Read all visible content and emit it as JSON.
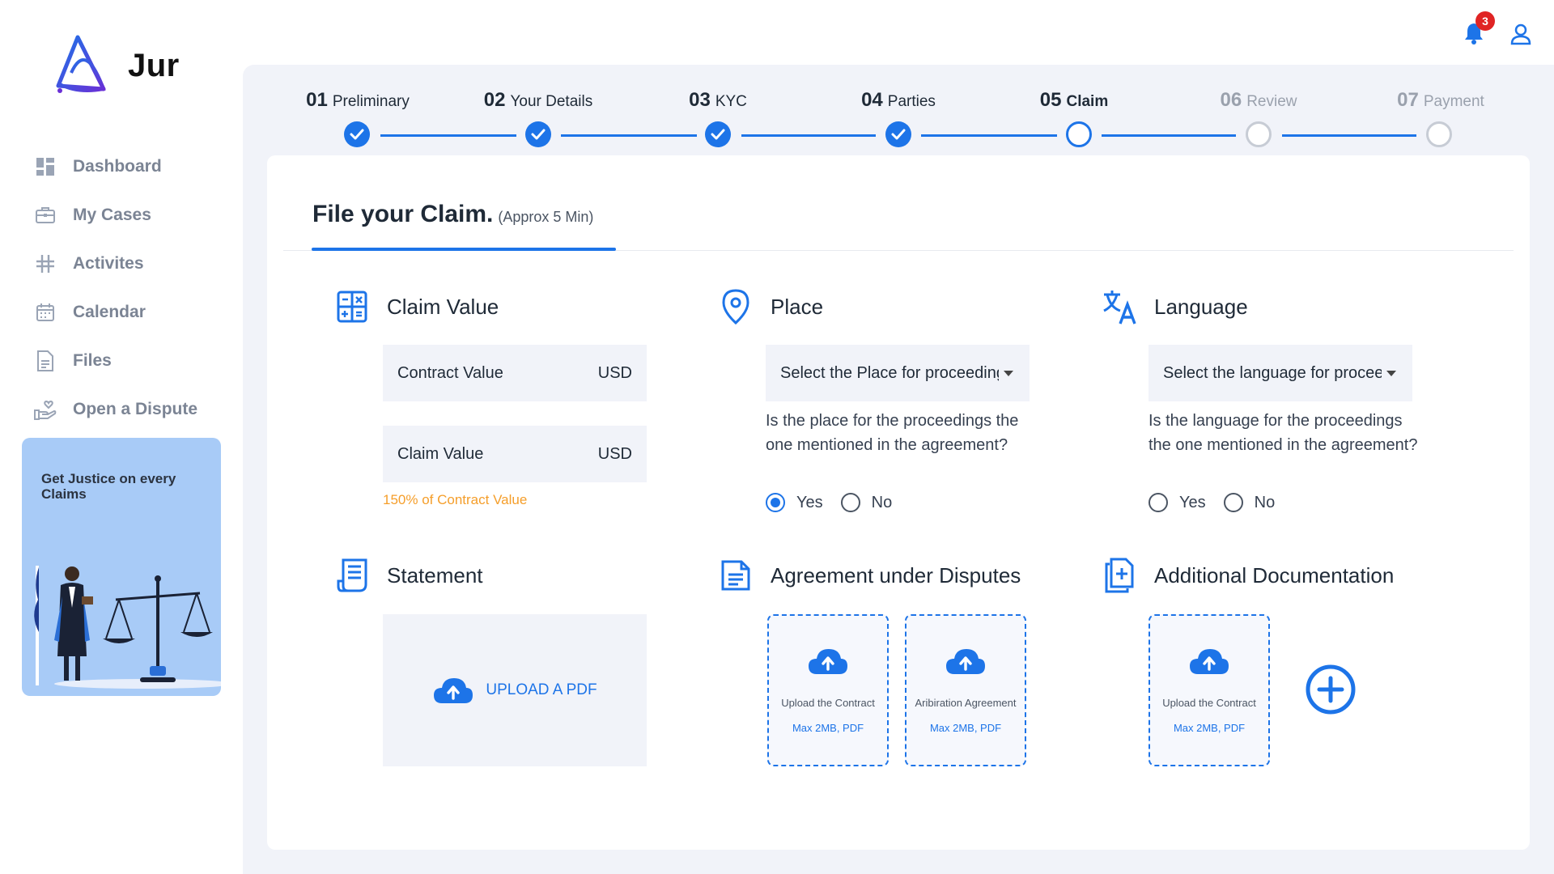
{
  "brand": {
    "name": "Jur"
  },
  "sidebar": {
    "items": [
      {
        "label": "Dashboard",
        "icon": "dashboard-icon"
      },
      {
        "label": "My Cases",
        "icon": "briefcase-icon"
      },
      {
        "label": "Activites",
        "icon": "hashtag-icon"
      },
      {
        "label": "Calendar",
        "icon": "calendar-icon"
      },
      {
        "label": "Files",
        "icon": "file-icon"
      },
      {
        "label": "Open a Dispute",
        "icon": "hand-heart-icon"
      }
    ],
    "promo": {
      "title": "Get Justice on every Claims"
    }
  },
  "header": {
    "notification_count": "3"
  },
  "stepper": {
    "steps": [
      {
        "num": "01",
        "label": "Preliminary",
        "state": "done"
      },
      {
        "num": "02",
        "label": "Your Details",
        "state": "done"
      },
      {
        "num": "03",
        "label": "KYC",
        "state": "done"
      },
      {
        "num": "04",
        "label": "Parties",
        "state": "done"
      },
      {
        "num": "05",
        "label": "Claim",
        "state": "current"
      },
      {
        "num": "06",
        "label": "Review",
        "state": "future"
      },
      {
        "num": "07",
        "label": "Payment",
        "state": "future"
      }
    ]
  },
  "form": {
    "title": "File your Claim.",
    "subtitle": "(Approx 5 Min)",
    "claim_value": {
      "heading": "Claim Value",
      "contract_label": "Contract Value",
      "contract_currency": "USD",
      "claim_label": "Claim Value",
      "claim_currency": "USD",
      "hint": "150% of Contract Value"
    },
    "place": {
      "heading": "Place",
      "select_placeholder": "Select the Place for proceedings",
      "question": "Is the place for the proceedings the one mentioned in the agreement?",
      "yes": "Yes",
      "no": "No",
      "selected": "Yes"
    },
    "language": {
      "heading": "Language",
      "select_placeholder": "Select the language for proceedings",
      "question": "Is the language for the proceedings the one mentioned in the agreement?",
      "yes": "Yes",
      "no": "No",
      "selected": ""
    },
    "statement": {
      "heading": "Statement",
      "upload_label": "UPLOAD A PDF"
    },
    "agreement": {
      "heading": "Agreement under Disputes",
      "uploads": [
        {
          "title": "Upload the Contract",
          "sub": "Max 2MB, PDF"
        },
        {
          "title": "Aribiration Agreement",
          "sub": "Max 2MB, PDF"
        }
      ]
    },
    "additional": {
      "heading": "Additional Documentation",
      "uploads": [
        {
          "title": "Upload the Contract",
          "sub": "Max 2MB, PDF"
        }
      ]
    }
  },
  "colors": {
    "accent": "#1d74e8",
    "hint": "#f59e2a",
    "panel": "#f1f3f9",
    "promo": "#a8cbf7",
    "badge": "#e02424"
  }
}
